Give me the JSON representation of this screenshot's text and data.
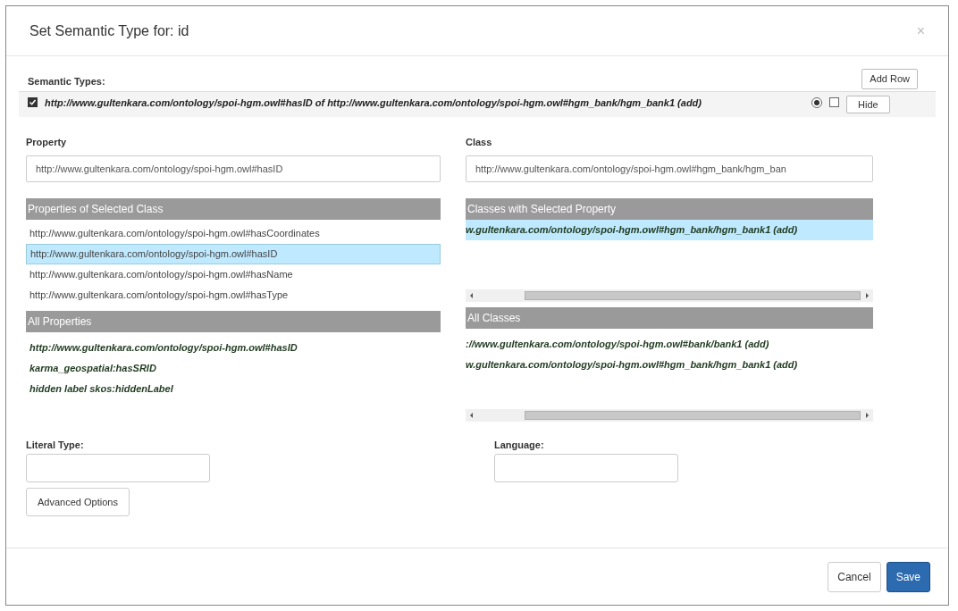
{
  "dialog": {
    "title": "Set Semantic Type for: id",
    "close": "×"
  },
  "semantic_types": {
    "label": "Semantic Types:",
    "add_row": "Add Row",
    "rows": [
      {
        "checked": true,
        "text": "http://www.gultenkara.com/ontology/spoi-hgm.owl#hasID of http://www.gultenkara.com/ontology/spoi-hgm.owl#hgm_bank/hgm_bank1 (add)",
        "primary": true,
        "marked": false,
        "hide": "Hide"
      }
    ]
  },
  "property": {
    "label": "Property",
    "value": "http://www.gultenkara.com/ontology/spoi-hgm.owl#hasID",
    "selected_class_header": "Properties of Selected Class",
    "selected_class_items": [
      {
        "text": "http://www.gultenkara.com/ontology/spoi-hgm.owl#hasCoordinates",
        "selected": false
      },
      {
        "text": "http://www.gultenkara.com/ontology/spoi-hgm.owl#hasID",
        "selected": true
      },
      {
        "text": "http://www.gultenkara.com/ontology/spoi-hgm.owl#hasName",
        "selected": false
      },
      {
        "text": "http://www.gultenkara.com/ontology/spoi-hgm.owl#hasType",
        "selected": false
      }
    ],
    "all_header": "All Properties",
    "all_items": [
      "http://www.gultenkara.com/ontology/spoi-hgm.owl#hasID",
      "karma_geospatial:hasSRID",
      "hidden label skos:hiddenLabel"
    ]
  },
  "class": {
    "label": "Class",
    "value": "http://www.gultenkara.com/ontology/spoi-hgm.owl#hgm_bank/hgm_ban",
    "selected_property_header": "Classes with Selected Property",
    "selected_property_items": [
      {
        "text": "w.gultenkara.com/ontology/spoi-hgm.owl#hgm_bank/hgm_bank1 (add)",
        "selected": true
      }
    ],
    "all_header": "All Classes",
    "all_items": [
      "://www.gultenkara.com/ontology/spoi-hgm.owl#bank/bank1 (add)",
      "w.gultenkara.com/ontology/spoi-hgm.owl#hgm_bank/hgm_bank1 (add)"
    ]
  },
  "literal_type": {
    "label": "Literal Type:"
  },
  "language": {
    "label": "Language:"
  },
  "advanced_options": "Advanced Options",
  "buttons": {
    "cancel": "Cancel",
    "save": "Save"
  }
}
